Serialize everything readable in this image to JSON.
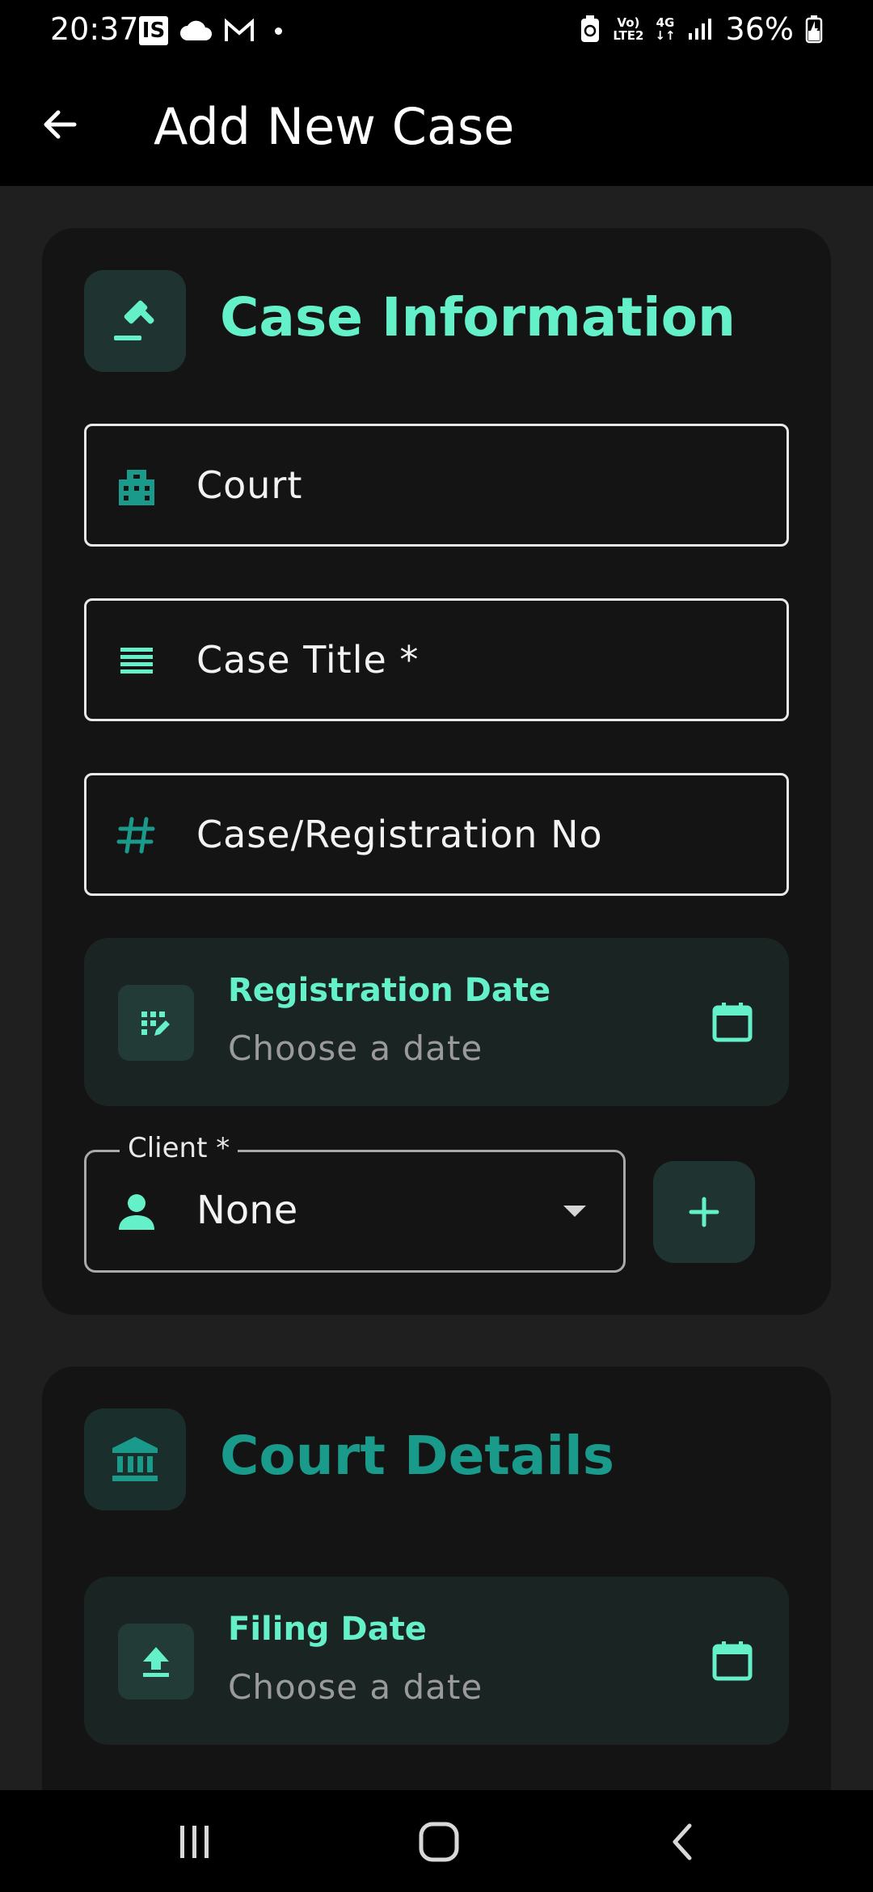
{
  "status_bar": {
    "time": "20:37",
    "box_icon_letter": "IS",
    "network_top": "Vo)",
    "network_bottom": "LTE2",
    "net_4g_top": "4G",
    "net_4g_bottom": "↓↑",
    "battery": "36%"
  },
  "appbar": {
    "title": "Add New Case"
  },
  "case_information": {
    "title": "Case Information",
    "court_label": "Court",
    "case_title_label": "Case Title *",
    "case_number_label": "Case/Registration No",
    "registration_date": {
      "title": "Registration Date",
      "placeholder": "Choose a date"
    },
    "client": {
      "legend": "Client *",
      "value": "None"
    }
  },
  "court_details": {
    "title": "Court Details",
    "filing_date": {
      "title": "Filing Date",
      "placeholder": "Choose a date"
    }
  },
  "colors": {
    "accent_mint": "#64f0c8",
    "accent_teal": "#199a8a",
    "card_bg": "#141414",
    "page_bg": "#1f1f1f"
  },
  "icons": [
    "back-arrow-icon",
    "gavel-icon",
    "building-icon",
    "lines-icon",
    "hash-icon",
    "edit-calendar-icon",
    "calendar-icon",
    "person-icon",
    "dropdown-caret-icon",
    "plus-icon",
    "bank-icon",
    "upload-icon",
    "recents-icon",
    "home-icon",
    "back-nav-icon"
  ]
}
